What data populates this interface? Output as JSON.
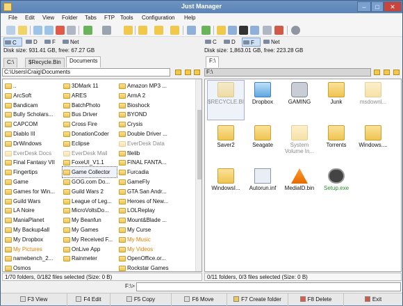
{
  "window": {
    "title": "Just Manager",
    "minimize": "–",
    "maximize": "□",
    "close": "✕"
  },
  "menu": [
    "File",
    "Edit",
    "View",
    "Folder",
    "Tabs",
    "FTP",
    "Tools",
    "Configuration",
    "Help"
  ],
  "left": {
    "drives": [
      "C",
      "D",
      "F",
      "Net"
    ],
    "disk_info": "Disk size: 931.41 GB, free: 67.27 GB",
    "tabs": [
      "C:\\",
      "$Recycle.Bin",
      "Documents"
    ],
    "path": "C:\\Users\\Craig\\Documents",
    "columns": [
      [
        "..",
        "ArcSoft",
        "Bandicam",
        "Bully Scholars...",
        "CAPCOM",
        "Diablo III",
        "DrWindows",
        "EverDesk Docs",
        "Final Fantasy VII",
        "Fingertips",
        "Game",
        "Games for Win...",
        "Guild Wars",
        "LA Noire",
        "ManiaPlanet",
        "My Backup4all",
        "My Dropbox",
        "My Pictures",
        "namebench_2...",
        "Osmos"
      ],
      [
        "3DMark 11",
        "ARES",
        "BatchPhoto",
        "Bus Driver",
        "Cross Fire",
        "DonationCoder",
        "Eclipse",
        "EverDesk Mail",
        "FoxeUI_V1.1",
        "Game Collector",
        "GOG.com Do...",
        "Guild Wars 2",
        "League of Leg...",
        "MicroVoltsDo...",
        "My Beanfun",
        "My Games",
        "My Received F...",
        "OnLive App",
        "Rainmeter"
      ],
      [
        "Amazon MP3 ...",
        "ArmA 2",
        "Bioshock",
        "BYOND",
        "Crysis",
        "Double Driver ...",
        "EverDesk Data",
        "filelib",
        "FINAL FANTA...",
        "Furcadia",
        "GameFly",
        "GTA San Andr...",
        "Heroes of New...",
        "LOLReplay",
        "Mount&Blade ...",
        "My Curse",
        "My Music",
        "My Videos",
        "OpenOffice.or...",
        "Rockstar Games"
      ]
    ],
    "status": "1/70 folders, 0/182 files selected (Size: 0 B)"
  },
  "right": {
    "drives": [
      "C",
      "D",
      "F",
      "Net"
    ],
    "disk_info": "Disk size: 1,863.01 GB, free: 223.28 GB",
    "tabs": [
      "F:\\"
    ],
    "path": "F:\\",
    "items": [
      {
        "name": "$RECYCLE.BIN",
        "type": "hidden"
      },
      {
        "name": "Dropbox",
        "type": "dropbox"
      },
      {
        "name": "GAMING",
        "type": "drive"
      },
      {
        "name": "Junk",
        "type": "folder"
      },
      {
        "name": "msdownl...",
        "type": "hidden"
      },
      {
        "name": "Saver2",
        "type": "folder"
      },
      {
        "name": "Seagate",
        "type": "folder"
      },
      {
        "name": "System Volume In...",
        "type": "hidden"
      },
      {
        "name": "Torrents",
        "type": "folder"
      },
      {
        "name": "Windows....",
        "type": "folder"
      },
      {
        "name": "WindowsI...",
        "type": "folder"
      },
      {
        "name": "Autorun.inf",
        "type": "inf"
      },
      {
        "name": "MediaID.bin",
        "type": "vlc"
      },
      {
        "name": "Setup.exe",
        "type": "exe"
      }
    ],
    "status": "0/11 folders, 0/3 files selected (Size: 0 B)"
  },
  "command": {
    "prompt": "F:\\>"
  },
  "fkeys": [
    "F3 View",
    "F4 Edit",
    "F5 Copy",
    "F6 Move",
    "F7 Create folder",
    "F8 Delete",
    "Exit"
  ]
}
